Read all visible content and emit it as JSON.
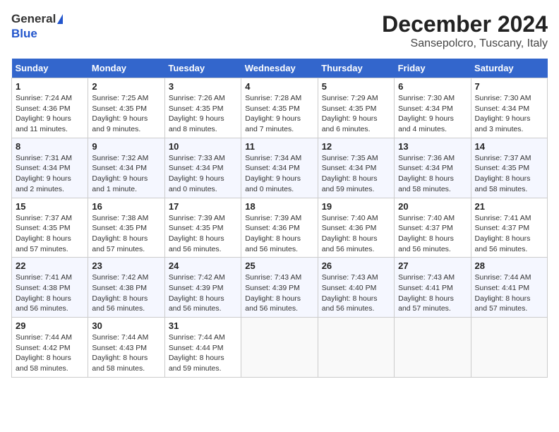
{
  "header": {
    "logo_general": "General",
    "logo_blue": "Blue",
    "title": "December 2024",
    "subtitle": "Sansepolcro, Tuscany, Italy"
  },
  "days_of_week": [
    "Sunday",
    "Monday",
    "Tuesday",
    "Wednesday",
    "Thursday",
    "Friday",
    "Saturday"
  ],
  "weeks": [
    [
      {
        "day": "1",
        "rise": "Sunrise: 7:24 AM",
        "set": "Sunset: 4:36 PM",
        "daylight": "Daylight: 9 hours and 11 minutes."
      },
      {
        "day": "2",
        "rise": "Sunrise: 7:25 AM",
        "set": "Sunset: 4:35 PM",
        "daylight": "Daylight: 9 hours and 9 minutes."
      },
      {
        "day": "3",
        "rise": "Sunrise: 7:26 AM",
        "set": "Sunset: 4:35 PM",
        "daylight": "Daylight: 9 hours and 8 minutes."
      },
      {
        "day": "4",
        "rise": "Sunrise: 7:28 AM",
        "set": "Sunset: 4:35 PM",
        "daylight": "Daylight: 9 hours and 7 minutes."
      },
      {
        "day": "5",
        "rise": "Sunrise: 7:29 AM",
        "set": "Sunset: 4:35 PM",
        "daylight": "Daylight: 9 hours and 6 minutes."
      },
      {
        "day": "6",
        "rise": "Sunrise: 7:30 AM",
        "set": "Sunset: 4:34 PM",
        "daylight": "Daylight: 9 hours and 4 minutes."
      },
      {
        "day": "7",
        "rise": "Sunrise: 7:30 AM",
        "set": "Sunset: 4:34 PM",
        "daylight": "Daylight: 9 hours and 3 minutes."
      }
    ],
    [
      {
        "day": "8",
        "rise": "Sunrise: 7:31 AM",
        "set": "Sunset: 4:34 PM",
        "daylight": "Daylight: 9 hours and 2 minutes."
      },
      {
        "day": "9",
        "rise": "Sunrise: 7:32 AM",
        "set": "Sunset: 4:34 PM",
        "daylight": "Daylight: 9 hours and 1 minute."
      },
      {
        "day": "10",
        "rise": "Sunrise: 7:33 AM",
        "set": "Sunset: 4:34 PM",
        "daylight": "Daylight: 9 hours and 0 minutes."
      },
      {
        "day": "11",
        "rise": "Sunrise: 7:34 AM",
        "set": "Sunset: 4:34 PM",
        "daylight": "Daylight: 9 hours and 0 minutes."
      },
      {
        "day": "12",
        "rise": "Sunrise: 7:35 AM",
        "set": "Sunset: 4:34 PM",
        "daylight": "Daylight: 8 hours and 59 minutes."
      },
      {
        "day": "13",
        "rise": "Sunrise: 7:36 AM",
        "set": "Sunset: 4:34 PM",
        "daylight": "Daylight: 8 hours and 58 minutes."
      },
      {
        "day": "14",
        "rise": "Sunrise: 7:37 AM",
        "set": "Sunset: 4:35 PM",
        "daylight": "Daylight: 8 hours and 58 minutes."
      }
    ],
    [
      {
        "day": "15",
        "rise": "Sunrise: 7:37 AM",
        "set": "Sunset: 4:35 PM",
        "daylight": "Daylight: 8 hours and 57 minutes."
      },
      {
        "day": "16",
        "rise": "Sunrise: 7:38 AM",
        "set": "Sunset: 4:35 PM",
        "daylight": "Daylight: 8 hours and 57 minutes."
      },
      {
        "day": "17",
        "rise": "Sunrise: 7:39 AM",
        "set": "Sunset: 4:35 PM",
        "daylight": "Daylight: 8 hours and 56 minutes."
      },
      {
        "day": "18",
        "rise": "Sunrise: 7:39 AM",
        "set": "Sunset: 4:36 PM",
        "daylight": "Daylight: 8 hours and 56 minutes."
      },
      {
        "day": "19",
        "rise": "Sunrise: 7:40 AM",
        "set": "Sunset: 4:36 PM",
        "daylight": "Daylight: 8 hours and 56 minutes."
      },
      {
        "day": "20",
        "rise": "Sunrise: 7:40 AM",
        "set": "Sunset: 4:37 PM",
        "daylight": "Daylight: 8 hours and 56 minutes."
      },
      {
        "day": "21",
        "rise": "Sunrise: 7:41 AM",
        "set": "Sunset: 4:37 PM",
        "daylight": "Daylight: 8 hours and 56 minutes."
      }
    ],
    [
      {
        "day": "22",
        "rise": "Sunrise: 7:41 AM",
        "set": "Sunset: 4:38 PM",
        "daylight": "Daylight: 8 hours and 56 minutes."
      },
      {
        "day": "23",
        "rise": "Sunrise: 7:42 AM",
        "set": "Sunset: 4:38 PM",
        "daylight": "Daylight: 8 hours and 56 minutes."
      },
      {
        "day": "24",
        "rise": "Sunrise: 7:42 AM",
        "set": "Sunset: 4:39 PM",
        "daylight": "Daylight: 8 hours and 56 minutes."
      },
      {
        "day": "25",
        "rise": "Sunrise: 7:43 AM",
        "set": "Sunset: 4:39 PM",
        "daylight": "Daylight: 8 hours and 56 minutes."
      },
      {
        "day": "26",
        "rise": "Sunrise: 7:43 AM",
        "set": "Sunset: 4:40 PM",
        "daylight": "Daylight: 8 hours and 56 minutes."
      },
      {
        "day": "27",
        "rise": "Sunrise: 7:43 AM",
        "set": "Sunset: 4:41 PM",
        "daylight": "Daylight: 8 hours and 57 minutes."
      },
      {
        "day": "28",
        "rise": "Sunrise: 7:44 AM",
        "set": "Sunset: 4:41 PM",
        "daylight": "Daylight: 8 hours and 57 minutes."
      }
    ],
    [
      {
        "day": "29",
        "rise": "Sunrise: 7:44 AM",
        "set": "Sunset: 4:42 PM",
        "daylight": "Daylight: 8 hours and 58 minutes."
      },
      {
        "day": "30",
        "rise": "Sunrise: 7:44 AM",
        "set": "Sunset: 4:43 PM",
        "daylight": "Daylight: 8 hours and 58 minutes."
      },
      {
        "day": "31",
        "rise": "Sunrise: 7:44 AM",
        "set": "Sunset: 4:44 PM",
        "daylight": "Daylight: 8 hours and 59 minutes."
      },
      null,
      null,
      null,
      null
    ]
  ]
}
